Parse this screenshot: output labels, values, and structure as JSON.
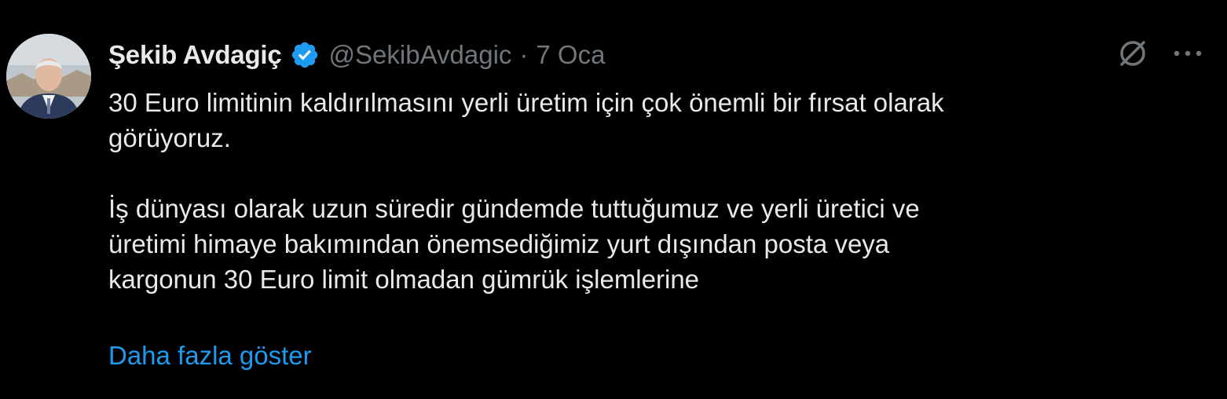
{
  "tweet": {
    "author_name": "Şekib Avdagiç",
    "handle": "@SekibAvdagic",
    "separator": "·",
    "date": "7 Oca",
    "verified_icon": "verified-badge-icon",
    "grok_icon": "grok-icon",
    "more_icon": "more-dots-icon",
    "text_lines_1": [
      "30 Euro limitinin kaldırılmasını yerli üretim için çok önemli bir fırsat olarak",
      "görüyoruz."
    ],
    "text_lines_2": [
      "İş dünyası olarak uzun süredir gündemde tuttuğumuz ve yerli üretici ve",
      "üretimi himaye bakımından önemsediğimiz yurt dışından posta veya",
      "kargonun 30 Euro limit olmadan gümrük işlemlerine"
    ],
    "show_more": "Daha fazla göster"
  },
  "colors": {
    "background": "#000000",
    "primary_text": "#e7e9ea",
    "secondary_text": "#71767b",
    "accent": "#1d9bf0"
  }
}
